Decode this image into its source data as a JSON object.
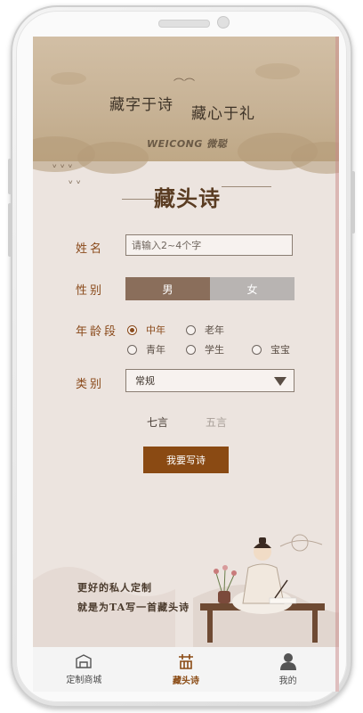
{
  "banner": {
    "line1": "藏字于诗",
    "line2": "藏心于礼",
    "brand": "WEICONG 微聪"
  },
  "page_title": "藏头诗",
  "form": {
    "name_label": "姓名",
    "name_placeholder": "请输入2~4个字",
    "gender_label": "性别",
    "gender_options": [
      "男",
      "女"
    ],
    "gender_selected": "男",
    "age_label": "年龄段",
    "age_options": [
      "中年",
      "老年",
      "青年",
      "学生",
      "宝宝"
    ],
    "age_selected": "中年",
    "type_label": "类别",
    "type_value": "常规",
    "poem_forms": [
      "七言",
      "五言"
    ],
    "poem_form_selected": "七言",
    "submit_label": "我要写诗"
  },
  "promo": {
    "line1": "更好的私人定制",
    "line2": "就是为TA写一首藏头诗"
  },
  "tabbar": [
    {
      "label": "定制商城",
      "icon": "mall-icon"
    },
    {
      "label": "藏头诗",
      "icon": "poem-icon"
    },
    {
      "label": "我的",
      "icon": "user-icon"
    }
  ],
  "colors": {
    "accent": "#8a4a13",
    "label": "#8a4a1b",
    "background": "#ece4df"
  }
}
